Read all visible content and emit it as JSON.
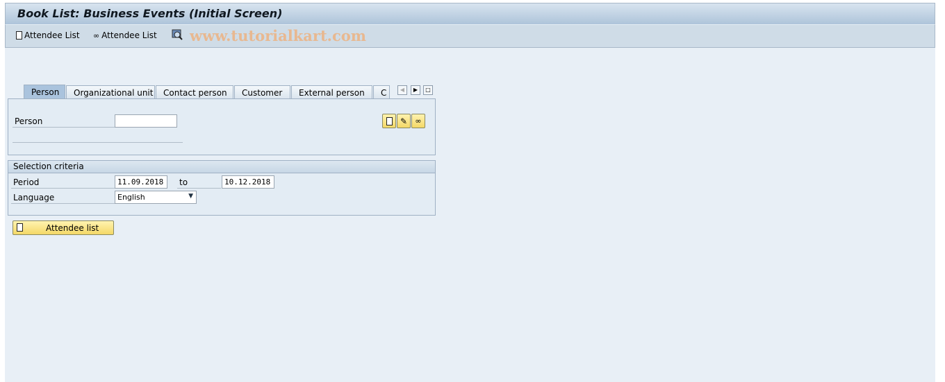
{
  "title": "Book List: Business Events (Initial Screen)",
  "toolbar": {
    "create_label": "Attendee List",
    "display_label": "Attendee List",
    "watermark": "www.tutorialkart.com"
  },
  "tabs": [
    {
      "label": "Person",
      "active": true
    },
    {
      "label": "Organizational unit"
    },
    {
      "label": "Contact person"
    },
    {
      "label": "Customer"
    },
    {
      "label": "External person"
    },
    {
      "label": "C"
    }
  ],
  "person": {
    "label": "Person",
    "value": ""
  },
  "selection": {
    "title": "Selection criteria",
    "period_label": "Period",
    "from": "11.09.2018",
    "to_label": "to",
    "to": "10.12.2018",
    "language_label": "Language",
    "language": "English"
  },
  "action": {
    "label": "Attendee list"
  },
  "colors": {
    "accent_button": "#f4d867",
    "active_tab": "#aac3dd"
  }
}
